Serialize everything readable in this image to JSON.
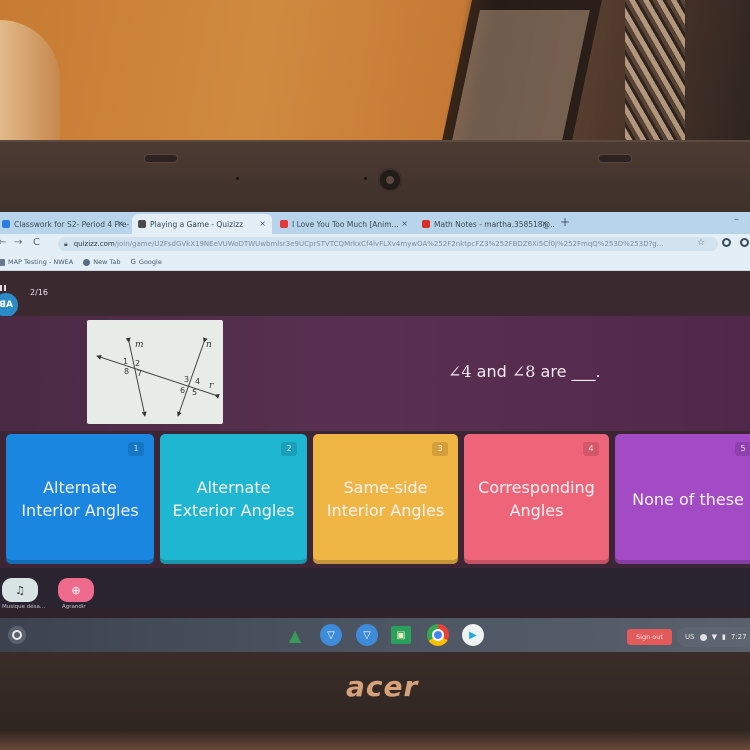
{
  "browser": {
    "tabs": [
      {
        "label": "Classwork for S2- Period 4 Pre-...",
        "favicon_color": "#2a7de1",
        "active": false
      },
      {
        "label": "Playing a Game - Quizizz",
        "favicon_color": "#4a4a4a",
        "active": true
      },
      {
        "label": "I Love You Too Much  [Anim...",
        "favicon_color": "#e53935",
        "active": false
      },
      {
        "label": "Math Notes - martha.358518@...",
        "favicon_color": "#d93025",
        "active": false
      }
    ],
    "close_glyph": "×",
    "new_tab_glyph": "+",
    "minimize_glyph": "–",
    "back_glyph": "←",
    "forward_glyph": "→",
    "reload_glyph": "C",
    "url_domain": "quizizz.com",
    "url_path": "/join/game/U2FsdGVkX19NEeVUWoDTWUwbmlsr3e9UCprSTVTCQMrkxCf4lvFLXv4mywOA%252F2nktpcFZ3%252FBDZ6Xi5Cf0j%252FmqQ%253D%253D?g...",
    "star_glyph": "☆",
    "bookmarks": [
      {
        "label": "MAP Testing - NWEA"
      },
      {
        "label": "New Tab"
      },
      {
        "label": "Google"
      }
    ]
  },
  "quiz": {
    "progress": "2/16",
    "avatar_text": "ꓭA",
    "question": {
      "angle_symbol": "∠",
      "angle_a": "4",
      "connector": " and ",
      "angle_b": "8",
      "suffix": " are ___."
    },
    "figure": {
      "line_labels": [
        "m",
        "n",
        "r"
      ],
      "angle_labels": [
        "1",
        "2",
        "3",
        "4",
        "5",
        "6",
        "7",
        "8"
      ]
    },
    "options": [
      {
        "number": "1",
        "label": "Alternate Interior Angles",
        "color": "#1a86e0"
      },
      {
        "number": "2",
        "label": "Alternate Exterior Angles",
        "color": "#1fb6d2"
      },
      {
        "number": "3",
        "label": "Same-side Interior Angles",
        "color": "#efb545"
      },
      {
        "number": "4",
        "label": "Corresponding Angles",
        "color": "#ee6478"
      },
      {
        "number": "5",
        "label": "None of these",
        "color": "#a24bc4"
      }
    ],
    "bottom_controls": [
      {
        "label": "Musique désa...",
        "icon": "music-off-icon",
        "glyph": "♫",
        "color": "#d8e4e4"
      },
      {
        "label": "Agrandir",
        "icon": "zoom-in-icon",
        "glyph": "⊕",
        "color": "#ef6b8d"
      }
    ]
  },
  "shelf": {
    "apps": [
      {
        "name": "google-drive-icon",
        "glyph": "▲",
        "color": "#3a9a5a"
      },
      {
        "name": "app-v-icon-1",
        "glyph": "▽",
        "color": "#3d8bd9"
      },
      {
        "name": "app-v-icon-2",
        "glyph": "▽",
        "color": "#3d8bd9"
      },
      {
        "name": "google-classroom-icon",
        "glyph": "▣",
        "color": "#2aa05a"
      },
      {
        "name": "chrome-icon",
        "glyph": "●",
        "color": "#e0b030"
      },
      {
        "name": "play-store-icon",
        "glyph": "▶",
        "color": "#f0f0f0"
      }
    ],
    "sign_out_label": "Sign out",
    "locale": "US",
    "time": "7:27"
  },
  "device": {
    "brand": "acer"
  }
}
